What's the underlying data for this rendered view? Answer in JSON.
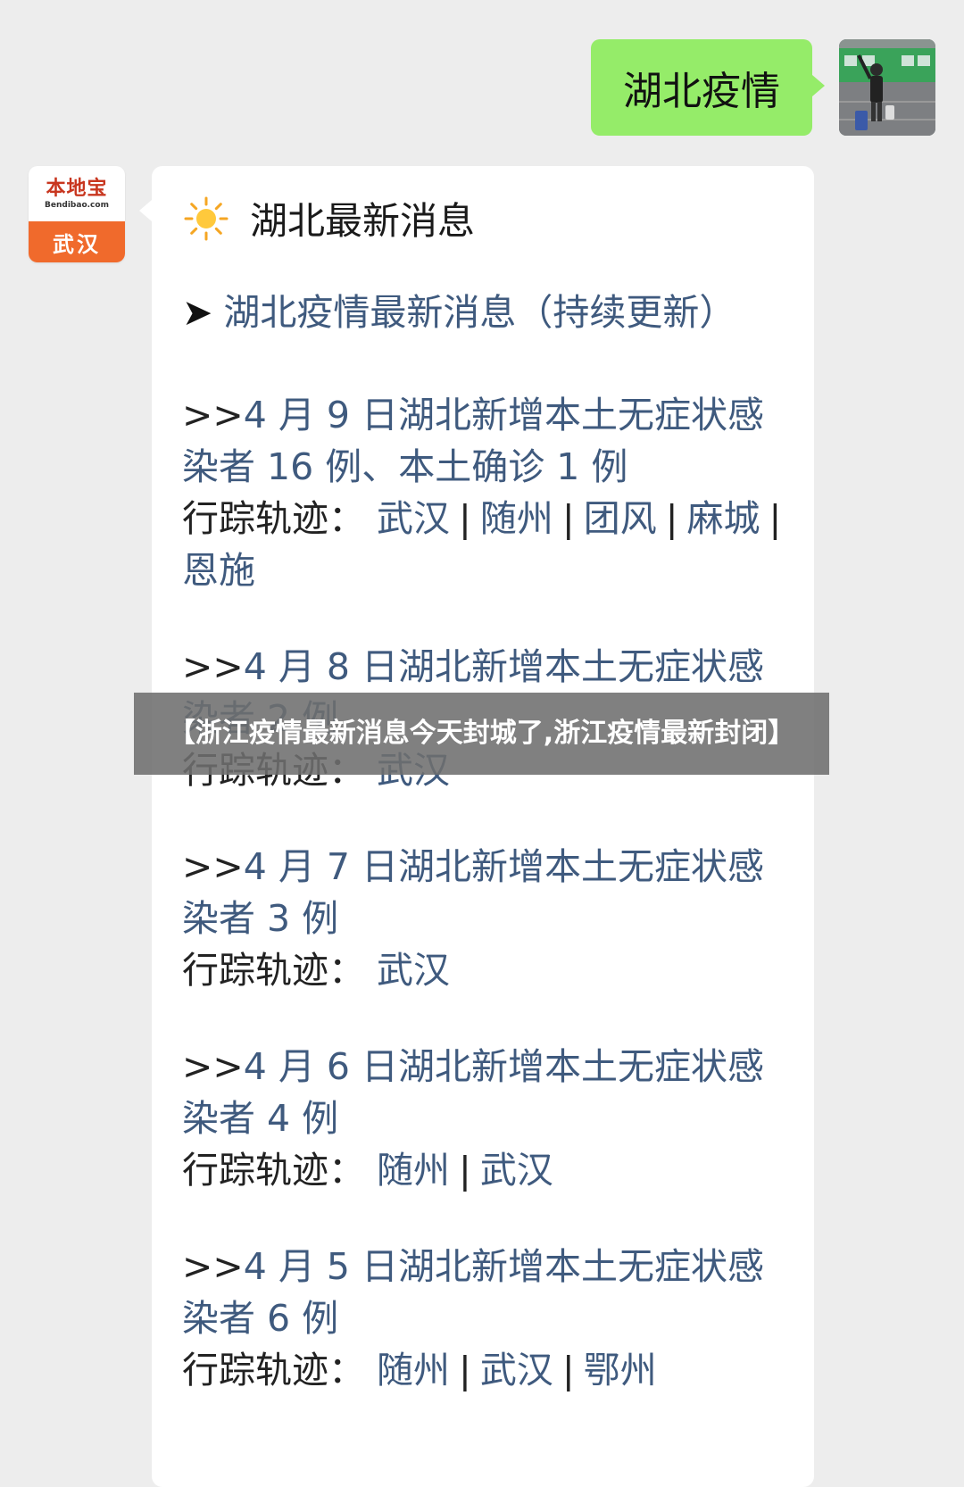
{
  "outgoing": {
    "text": "湖北疫情"
  },
  "bot": {
    "brand": "本地宝",
    "domain": "Bendibao.com",
    "city": "武汉"
  },
  "card": {
    "title": "湖北最新消息",
    "headline": "湖北疫情最新消息（持续更新）",
    "entries": [
      {
        "prefix": ">>",
        "report": "4 月 9 日湖北新增本土无症状感染者 16 例、本土确诊 1 例",
        "track_label": "行踪轨迹：",
        "places": [
          "武汉",
          "随州",
          "团风",
          "麻城",
          "恩施"
        ]
      },
      {
        "prefix": ">>",
        "report": "4 月 8 日湖北新增本土无症状感染者 2 例",
        "track_label": "行踪轨迹：",
        "places": [
          "武汉"
        ]
      },
      {
        "prefix": ">>",
        "report": "4 月 7 日湖北新增本土无症状感染者 3 例",
        "track_label": "行踪轨迹：",
        "places": [
          "武汉"
        ]
      },
      {
        "prefix": ">>",
        "report": "4 月 6 日湖北新增本土无症状感染者 4 例",
        "track_label": "行踪轨迹：",
        "places": [
          "随州",
          "武汉"
        ]
      },
      {
        "prefix": ">>",
        "report": "4 月 5 日湖北新增本土无症状感染者 6 例",
        "track_label": "行踪轨迹：",
        "places": [
          "随州",
          "武汉",
          "鄂州"
        ]
      }
    ]
  },
  "overlay": {
    "title": "【浙江疫情最新消息今天封城了,浙江疫情最新封闭】"
  }
}
